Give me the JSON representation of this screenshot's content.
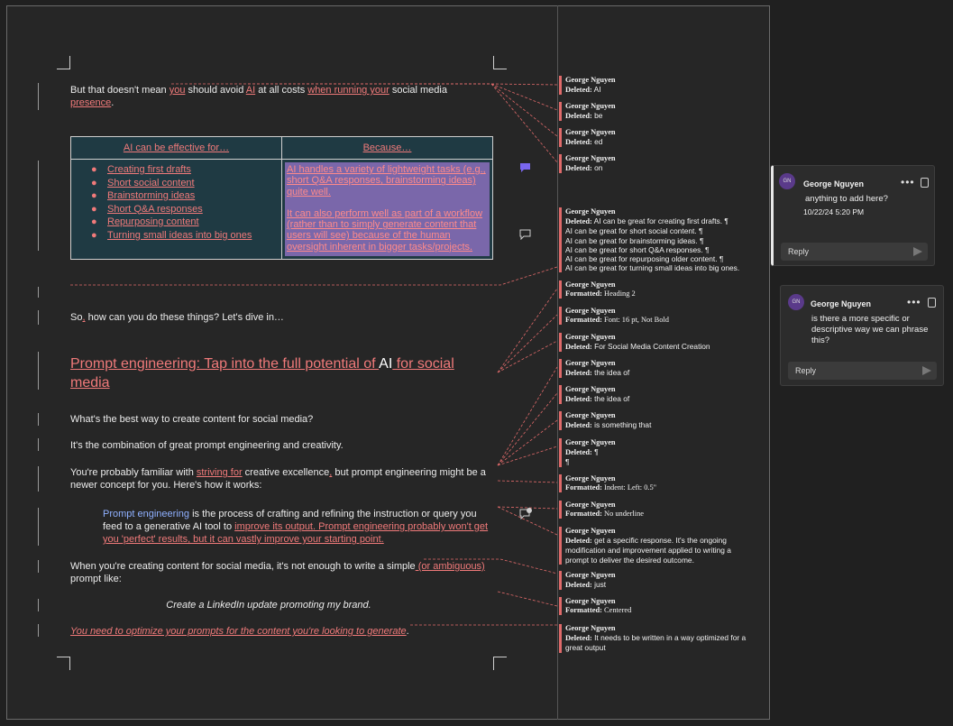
{
  "document": {
    "para1": {
      "pre": "But that doesn't mean ",
      "ins1": "you",
      "mid1": " should avoid ",
      "ins2": "AI",
      "mid2": " at all costs ",
      "ins3": "when running your",
      "mid3": " social media",
      "ins4": "presence",
      "end": "."
    },
    "table": {
      "col1_header": "AI can be effective for…",
      "col2_header": "Because…",
      "bullets": [
        "Creating first drafts",
        "Short social content",
        "Brainstorming ideas",
        "Short Q&A responses",
        "Repurposing content",
        "Turning small ideas into big ones"
      ],
      "bullet_char": "●",
      "because_p1": "AI handles a variety of lightweight tasks (e.g., short Q&A responses, brainstorming ideas) quite well.",
      "because_p2": "It can also perform well as part of a workflow (rather than to simply generate content that users will see) because of the human oversight inherent in bigger tasks/projects."
    },
    "para2": {
      "pre": "So",
      "ins": ",",
      "end": " how can you do these things? Let's dive in…"
    },
    "heading": {
      "part1": "Prompt engineering: Tap into the full potential of ",
      "part2": "AI",
      "part3": " for social",
      "part4": "media"
    },
    "para3": "What's the best way to create content for social media?",
    "para4": "It's the combination of great prompt engineering and creativity.",
    "para5": {
      "pre": "You're probably familiar with ",
      "ins": "striving for",
      "mid": " creative excellence",
      "ins2": ",",
      "end": " but prompt engineering might be a",
      "line2": "newer concept for you. Here's how it works:"
    },
    "quote": {
      "term": "Prompt engineering",
      "l1": " is the process of crafting and refining the instruction or query you",
      "l2pre": "feed to a generative AI tool to ",
      "l2ins": "improve its output. Prompt engineering probably won't get",
      "l3ins": "you 'perfect' results, but it can vastly improve your starting point."
    },
    "para6": {
      "pre": "When you're creating content for social media, it's not enough to write a simple",
      "ins": " (or ambiguous)",
      "line2": "prompt like:"
    },
    "centered": "Create a LinkedIn update promoting my brand.",
    "final": {
      "ins": "You need to optimize your prompts for the content you're looking to generate",
      "end": "."
    }
  },
  "revisions": [
    {
      "author": "George Nguyen",
      "label": "Deleted:",
      "text": " AI"
    },
    {
      "author": "George Nguyen",
      "label": "Deleted:",
      "text": " be"
    },
    {
      "author": "George Nguyen",
      "label": "Deleted:",
      "text": " ed"
    },
    {
      "author": "George Nguyen",
      "label": "Deleted:",
      "text": " on"
    },
    {
      "author": "George Nguyen",
      "label": "Deleted:",
      "text": " AI can be great for creating first drafts. ¶",
      "extra": [
        "AI can be great for short social content. ¶",
        "AI can be great for brainstorming ideas. ¶",
        "AI can be great for short Q&A responses. ¶",
        "AI can be great for repurposing older content. ¶",
        "AI can be great for turning small ideas into big ones."
      ]
    },
    {
      "author": "George Nguyen",
      "label": "Formatted:",
      "text": " Heading 2"
    },
    {
      "author": "George Nguyen",
      "label": "Formatted:",
      "text": " Font: 16 pt, Not Bold"
    },
    {
      "author": "George Nguyen",
      "label": "Deleted:",
      "text": "  For Social Media Content Creation"
    },
    {
      "author": "George Nguyen",
      "label": "Deleted:",
      "text": " the idea of"
    },
    {
      "author": "George Nguyen",
      "label": "Deleted:",
      "text": "  the idea of"
    },
    {
      "author": "George Nguyen",
      "label": "Deleted:",
      "text": " is something that"
    },
    {
      "author": "George Nguyen",
      "label": "Deleted:",
      "text": " ¶",
      "extra": [
        "¶"
      ]
    },
    {
      "author": "George Nguyen",
      "label": "Formatted:",
      "text": " Indent: Left:  0.5\""
    },
    {
      "author": "George Nguyen",
      "label": "Formatted:",
      "text": " No underline"
    },
    {
      "author": "George Nguyen",
      "label": "Deleted:",
      "text": " get a specific response. It's the ongoing",
      "extra": [
        "modification and improvement applied to writing a",
        "prompt to deliver the desired outcome."
      ]
    },
    {
      "author": "George Nguyen",
      "label": "Deleted:",
      "text": " just"
    },
    {
      "author": "George Nguyen",
      "label": "Formatted:",
      "text": " Centered"
    },
    {
      "author": "George Nguyen",
      "label": "Deleted:",
      "text": " It needs to be written in a way optimized for a",
      "extra": [
        "great output"
      ]
    }
  ],
  "comments": [
    {
      "initials": "GN",
      "author": "George Nguyen",
      "text": "anything to add here?",
      "date": "10/22/24 5:20 PM",
      "reply_placeholder": "Reply",
      "more": "•••"
    },
    {
      "initials": "GN",
      "author": "George Nguyen",
      "text": "is there a more specific or descriptive way we can phrase this?",
      "reply_placeholder": "Reply",
      "more": "•••"
    }
  ],
  "colors": {
    "insert": "#f07a7a",
    "revision_bar": "#e06a6a",
    "selection": "#7a67aa",
    "table_bg": "#1f3a43",
    "link_blue": "#8fb0ff"
  },
  "icons": [
    "comment-filled-icon",
    "comment-outline-icon",
    "comment-resolved-icon",
    "more-options-icon",
    "like-icon",
    "send-icon"
  ]
}
